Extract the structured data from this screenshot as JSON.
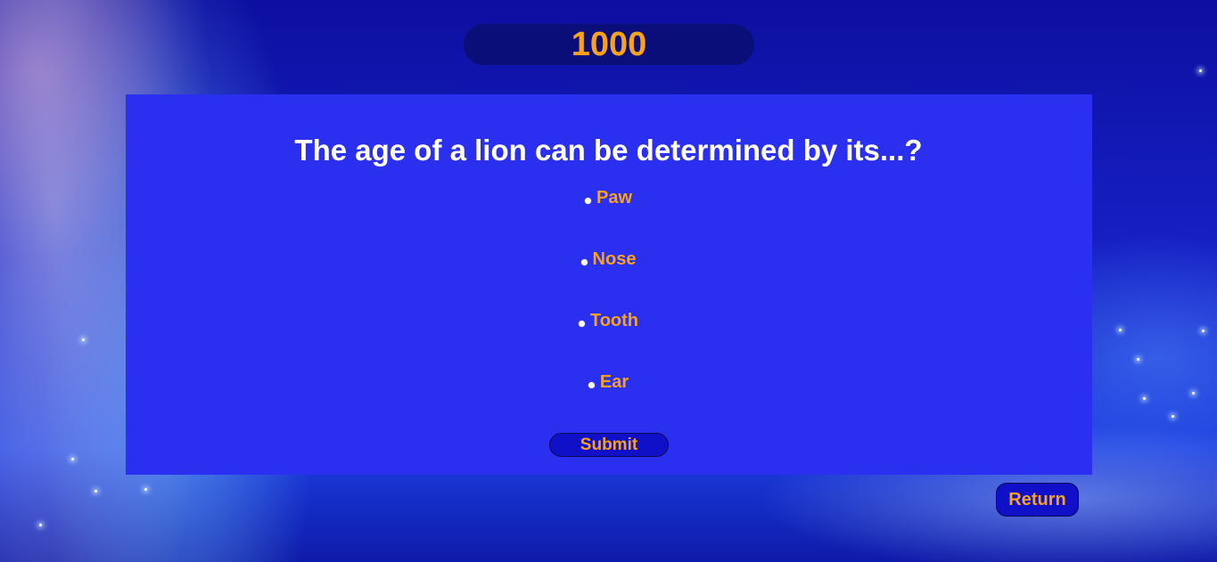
{
  "score": {
    "value": "1000"
  },
  "quiz": {
    "question": "The age of a lion can be determined by its...?",
    "options": [
      {
        "label": "Paw"
      },
      {
        "label": "Nose"
      },
      {
        "label": "Tooth"
      },
      {
        "label": "Ear"
      }
    ],
    "submit_label": "Submit"
  },
  "navigation": {
    "return_label": "Return"
  },
  "colors": {
    "accent_text": "#f8a21c",
    "card_background": "#2a2ff0",
    "button_background": "#1010c8",
    "score_background": "#0a0e78"
  }
}
